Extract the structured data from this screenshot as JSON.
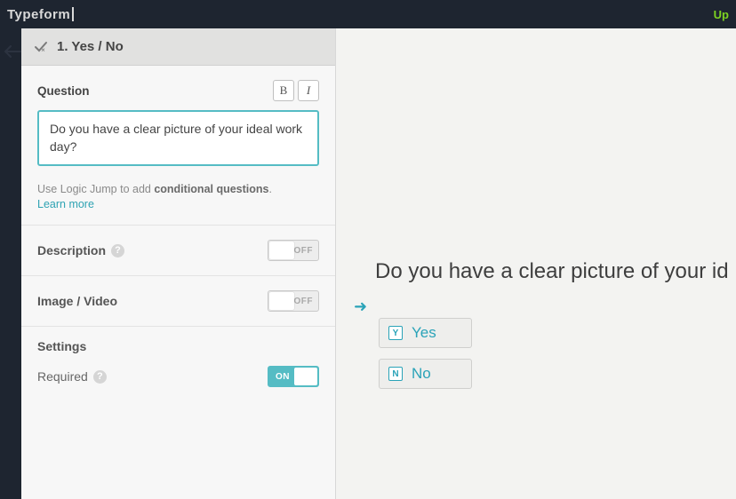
{
  "header": {
    "brand": "Typeform",
    "upgrade": "Up"
  },
  "editor": {
    "title": "1. Yes / No",
    "question_section_label": "Question",
    "bold_label": "B",
    "italic_label": "I",
    "question_text": "Do you have a clear picture of your ideal work day?",
    "hint_prefix": "Use Logic Jump to add ",
    "hint_bold": "conditional questions",
    "hint_suffix": ".",
    "learn_more": "Learn more",
    "description_label": "Description",
    "imagevideo_label": "Image / Video",
    "settings_label": "Settings",
    "required_label": "Required",
    "toggle_off_label": "OFF",
    "toggle_on_label": "ON"
  },
  "preview": {
    "question": "Do you have a clear picture of your id",
    "answers": [
      {
        "key": "Y",
        "label": "Yes"
      },
      {
        "key": "N",
        "label": "No"
      }
    ]
  }
}
